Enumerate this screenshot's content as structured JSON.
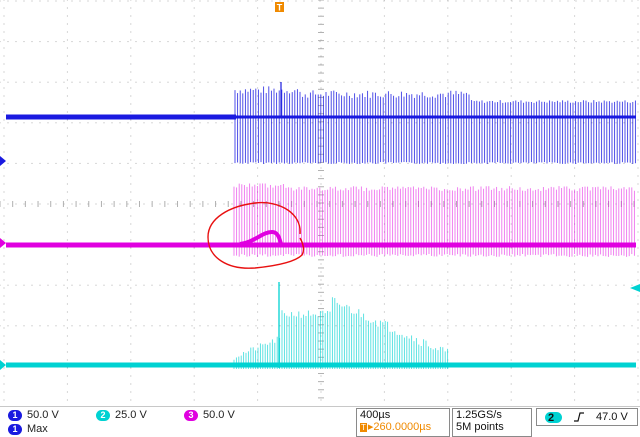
{
  "colors": {
    "ch1": "#1a1ae0",
    "ch2": "#00d2d2",
    "ch3": "#e000e0",
    "trigger": "#f08a00",
    "annotation": "#e81010",
    "grid": "#b0b0b0"
  },
  "trigger_marker": {
    "icon": "trigger-T-icon",
    "glyph": "T"
  },
  "channels": [
    {
      "id": "1",
      "scale": "50.0 V"
    },
    {
      "id": "2",
      "scale": "25.0 V"
    },
    {
      "id": "3",
      "scale": "50.0 V"
    }
  ],
  "measurement": {
    "id": "1",
    "label": "Max"
  },
  "timebase": {
    "per_div": "400µs",
    "position": "▸260.0000µs"
  },
  "acquisition": {
    "rate": "1.25GS/s",
    "points": "5M points"
  },
  "trigger": {
    "channel": "2",
    "slope_icon": "rising-edge-icon",
    "level": "47.0 V"
  }
}
